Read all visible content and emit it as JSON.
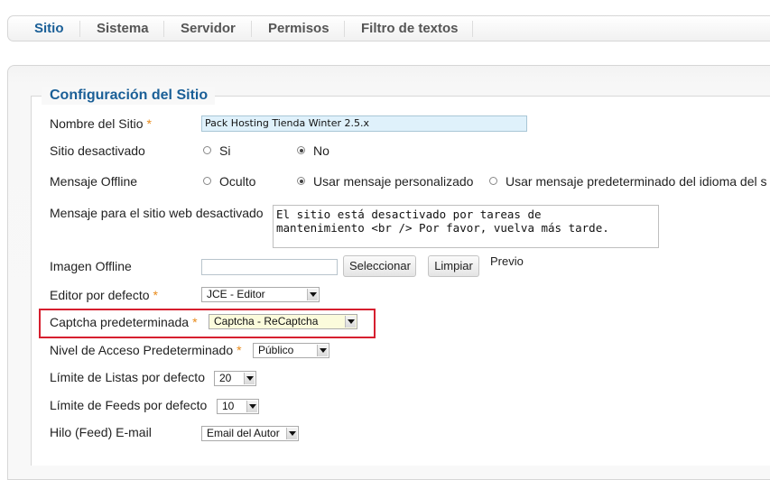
{
  "tabs": [
    {
      "label": "Sitio",
      "active": true
    },
    {
      "label": "Sistema"
    },
    {
      "label": "Servidor"
    },
    {
      "label": "Permisos"
    },
    {
      "label": "Filtro de textos"
    }
  ],
  "section": {
    "title": "Configuración del Sitio"
  },
  "fields": {
    "site_name": {
      "label": "Nombre del Sitio",
      "value": "Pack Hosting Tienda Winter 2.5.x"
    },
    "site_offline": {
      "label": "Sitio desactivado",
      "options": [
        "Si",
        "No"
      ],
      "selected": "No"
    },
    "offline_message": {
      "label": "Mensaje Offline",
      "options": [
        "Oculto",
        "Usar mensaje personalizado",
        "Usar mensaje predeterminado del idioma del s"
      ],
      "selected": "Usar mensaje personalizado"
    },
    "offline_text": {
      "label": "Mensaje para el sitio web desactivado",
      "value": "El sitio está desactivado por tareas de\nmantenimiento <br /> Por favor, vuelva más tarde."
    },
    "offline_image": {
      "label": "Imagen Offline",
      "value": "",
      "select_label": "Seleccionar",
      "clear_label": "Limpiar",
      "preview_label": "Previo"
    },
    "default_editor": {
      "label": "Editor por defecto",
      "value": "JCE - Editor"
    },
    "default_captcha": {
      "label": "Captcha predeterminada",
      "value": "Captcha - ReCaptcha"
    },
    "default_access": {
      "label": "Nivel de Acceso Predeterminado",
      "value": "Público"
    },
    "list_limit": {
      "label": "Límite de Listas por defecto",
      "value": "20"
    },
    "feed_limit": {
      "label": "Límite de Feeds por defecto",
      "value": "10"
    },
    "feed_email": {
      "label": "Hilo (Feed) E-mail",
      "value": "Email del Autor"
    }
  },
  "required_marker": "*",
  "colors": {
    "accent": "#1a5f97",
    "required": "#e88a1a",
    "highlight_box": "#d61f2f"
  }
}
